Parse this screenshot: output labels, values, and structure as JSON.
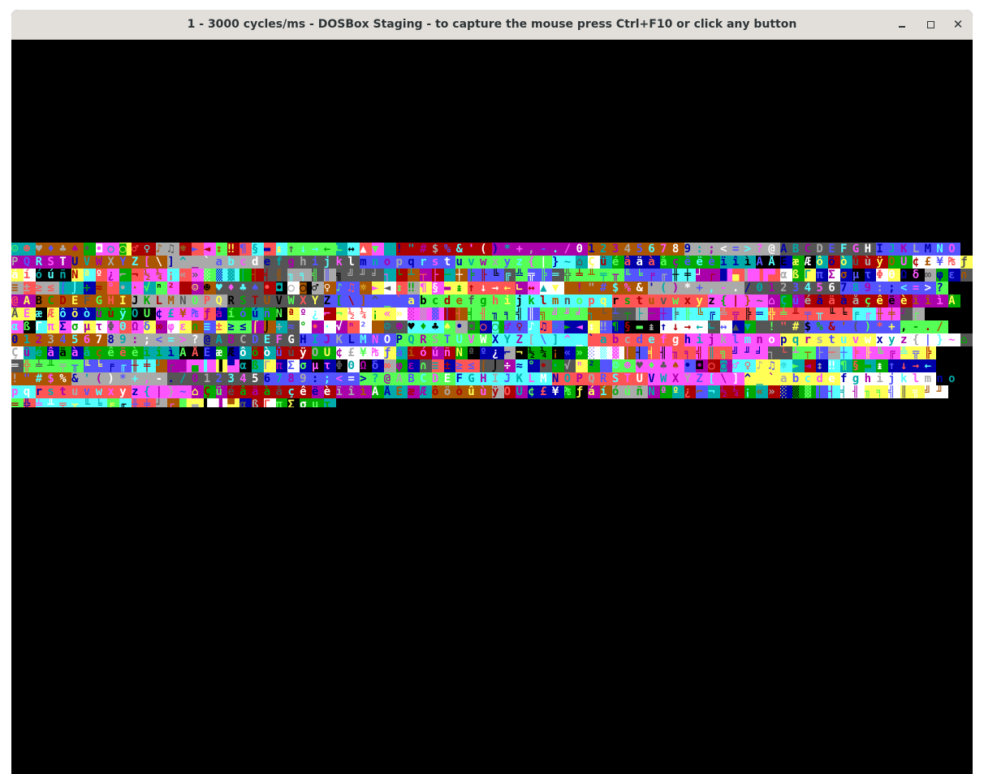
{
  "window": {
    "title": "1 - 3000 cycles/ms - DOSBox Staging - to capture the mouse press Ctrl+F10 or click any button",
    "controls": {
      "minimize": "minimize-icon",
      "maximize": "maximize-icon",
      "close": "close-icon"
    }
  },
  "colors": {
    "titlebar_bg": "#e2dfdb",
    "title_text": "#2e3436",
    "screen_bg": "#000000",
    "vga_palette": [
      "#000000",
      "#0000aa",
      "#00aa00",
      "#00aaaa",
      "#aa0000",
      "#aa00aa",
      "#aa5500",
      "#aaaaaa",
      "#555555",
      "#5555ff",
      "#55ff55",
      "#55ffff",
      "#ff5555",
      "#ff55ff",
      "#ffff55",
      "#ffffff"
    ]
  },
  "screen": {
    "content": "Garbled CP437 character/color pattern rendered across the DOS text screen (approx. 12 rows in the middle of the window)",
    "rows": [
      "☺☻♥♦♣♠•◘○◙♂♀♪♫☼►◄↕‼¶§▬↨↑↓→←∟↔▲▼ !\"#$%&'()*+,-./0123456789:;<=>?@ABCDEFGHIJKLMNO",
      "PQRSTUVWXYZ[\\]^_`abcdefghijklmnopqrstuvwxyz{|}~⌂ÇüéâäàåçêëèïîìÄÅÉæÆôöòûùÿÖÜ¢£¥₧ƒ",
      "áíóúñÑªº¿⌐¬½¼¡«»░▒▓│┤╡╢╖╕╣║╗╝╜╛┐└┴┬├─┼╞╟╚╔╩╦╠═╬╧╨╤╥╙╘╒╓╫╪┘┌█▄▌▐▀αßΓπΣσµτΦΘΩδ∞φε∩",
      "≡±≥≤⌠⌡÷≈°∙·√ⁿ² ☺☻♥♦♣♠•◘○◙♂♀♪♫☼►◄↕‼¶§▬↨↑↓→←∟↔▲▼ !\"#$%&'()*+,-./0123456789:;<=>?",
      "@ABCDEFGHIJKLMNOPQRSTUVWXYZ[\\]^_`abcdefghijklmnopqrstuvwxyz{|}~⌂ÇüéâäàåçêëèïîìÄ",
      "ÅÉæÆôöòûùÿÖÜ¢£¥₧ƒáíóúñÑªº¿⌐¬½¼¡«»░▒▓│┤╡╢╖╕╣║╗╝╜╛┐└┴┬├─┼╞╟╚╔╩╦╠═╬╧╨╤╥╙╘╒╓╫╪┘┌",
      "αßΓπΣσµτΦΘΩδ∞φε∩≡±≥≤⌠⌡÷≈°∙·√ⁿ² ☺☻♥♦♣♠•◘○◙♂♀♪♫☼►◄↕‼¶§▬↨↑↓→←∟↔▲▼ !\"#$%&'()*+,-./",
      "0123456789:;<=>?@ABCDEFGHIJKLMNOPQRSTUVWXYZ[\\]^_`abcdefghijklmnopqrstuvwxyz{|}~⌂",
      "ÇüéâäàåçêëèïîìÄÅÉæÆôöòûùÿÖÜ¢£¥₧ƒáíóúñÑªº¿⌐¬½¼¡«»░▒▓│┤╡╢╖╕╣║╗╝╜╛┐└┴┬├─┼╞╟╚╔╩╦╠",
      "═╬╧╨╤╥╙╘╒╓╫╪┘┌█▄▌▐▀αßΓπΣσµτΦΘΩδ∞φε∩≡±≥≤⌠⌡÷≈°∙·√ⁿ² ☺☻♥♦♣♠•◘○◙♂♀♪♫☼►◄↕‼¶§▬↨↑↓→←",
      "!\"#$%&'()*+,-./0123456789:;<=>?@ABCDEFGHIJKLMNOPQRSTUVWXYZ[\\]^_`abcdefghijklmno",
      "pqrstuvwxyz{|}~⌂ÇüéâäàåçêëèïîìÄÅÉæÆôöòûùÿÖÜ¢£¥₧ƒáíóúñÑªº¿⌐¬½¼¡«»░▒▓│┤╡╢╖╕╣║╗╝╜"
    ],
    "last_row_partial": "═╬╧╨╤╥╙╘╒╓╫╪┘┌█▄▌▐▀αßΓπΣσµτ"
  }
}
